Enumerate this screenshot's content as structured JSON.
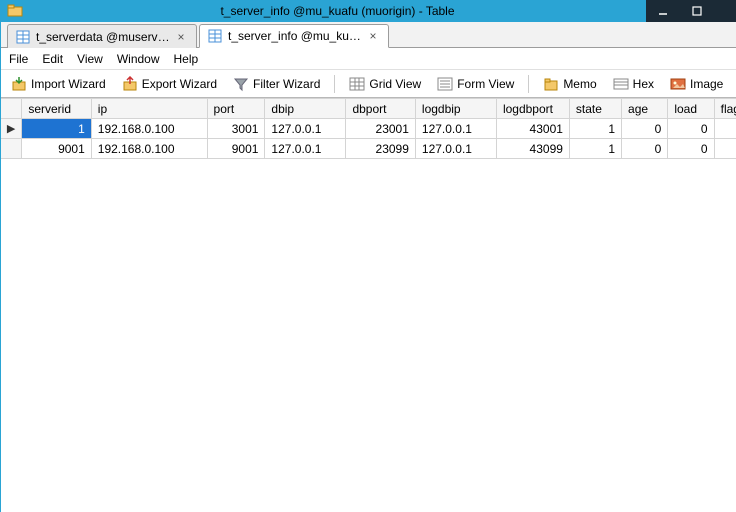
{
  "window": {
    "title": "t_server_info @mu_kuafu (muorigin) - Table"
  },
  "tabs": [
    {
      "label": "t_serverdata @muserve…",
      "active": false
    },
    {
      "label": "t_server_info @mu_kuaf…",
      "active": true
    }
  ],
  "menu": {
    "file": "File",
    "edit": "Edit",
    "view": "View",
    "window": "Window",
    "help": "Help"
  },
  "toolbar": {
    "import_wizard": "Import Wizard",
    "export_wizard": "Export Wizard",
    "filter_wizard": "Filter Wizard",
    "grid_view": "Grid View",
    "form_view": "Form View",
    "memo": "Memo",
    "hex": "Hex",
    "image": "Image"
  },
  "columns": {
    "serverid": "serverid",
    "ip": "ip",
    "port": "port",
    "dbip": "dbip",
    "dbport": "dbport",
    "logdbip": "logdbip",
    "logdbport": "logdbport",
    "state": "state",
    "age": "age",
    "load": "load",
    "flags": "flags"
  },
  "rows": [
    {
      "serverid": "1",
      "ip": "192.168.0.100",
      "port": "3001",
      "dbip": "127.0.0.1",
      "dbport": "23001",
      "logdbip": "127.0.0.1",
      "logdbport": "43001",
      "state": "1",
      "age": "0",
      "load": "0",
      "flags": ""
    },
    {
      "serverid": "9001",
      "ip": "192.168.0.100",
      "port": "9001",
      "dbip": "127.0.0.1",
      "dbport": "23099",
      "logdbip": "127.0.0.1",
      "logdbport": "43099",
      "state": "1",
      "age": "0",
      "load": "0",
      "flags": ""
    }
  ],
  "selection": {
    "row": 0,
    "col": "serverid"
  }
}
